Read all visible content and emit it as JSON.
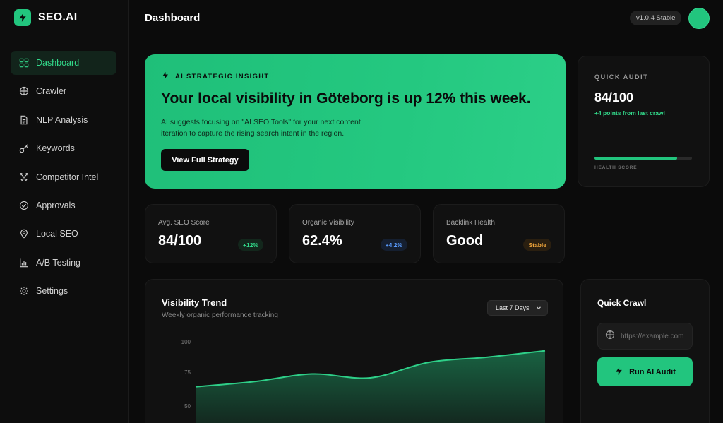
{
  "brand": {
    "name": "SEO.AI",
    "logo_icon": "bolt-icon",
    "accent": "#22c57e"
  },
  "sidebar": {
    "items": [
      {
        "label": "Dashboard",
        "icon": "grid-icon",
        "active": true
      },
      {
        "label": "Crawler",
        "icon": "globe-icon",
        "active": false
      },
      {
        "label": "NLP Analysis",
        "icon": "document-icon",
        "active": false
      },
      {
        "label": "Keywords",
        "icon": "key-icon",
        "active": false
      },
      {
        "label": "Competitor Intel",
        "icon": "swords-icon",
        "active": false
      },
      {
        "label": "Approvals",
        "icon": "check-circle-icon",
        "active": false
      },
      {
        "label": "Local SEO",
        "icon": "map-pin-icon",
        "active": false
      },
      {
        "label": "A/B Testing",
        "icon": "bar-chart-icon",
        "active": false
      },
      {
        "label": "Settings",
        "icon": "gear-icon",
        "active": false
      }
    ]
  },
  "header": {
    "title": "Dashboard",
    "version": "v1.0.4 Stable"
  },
  "insight": {
    "tag": "AI STRATEGIC INSIGHT",
    "headline": "Your local visibility in Göteborg is up 12% this week.",
    "body": "AI suggests focusing on \"AI SEO Tools\" for your next content iteration to capture the rising search intent in the region.",
    "button": "View Full Strategy"
  },
  "quick_audit": {
    "label": "QUICK AUDIT",
    "score": "84/100",
    "delta": "+4 points from last crawl",
    "health_label": "HEALTH SCORE",
    "health_fraction": 0.85
  },
  "stats": [
    {
      "label": "Avg. SEO Score",
      "value": "84/100",
      "badge": "+12%",
      "badge_color": "#32d98a"
    },
    {
      "label": "Organic Visibility",
      "value": "62.4%",
      "badge": "+4.2%",
      "badge_color": "#5a9cff"
    },
    {
      "label": "Backlink Health",
      "value": "Good",
      "badge": "Stable",
      "badge_color": "#f2a73b"
    }
  ],
  "trend": {
    "title": "Visibility Trend",
    "subtitle": "Weekly organic performance tracking",
    "range": "Last 7 Days"
  },
  "chart_data": {
    "type": "area",
    "x": [
      0,
      1,
      2,
      3,
      4,
      5,
      6
    ],
    "values": [
      65,
      69,
      75,
      72,
      84,
      88,
      93
    ],
    "ylim": [
      40,
      100
    ],
    "yticks": [
      "100",
      "75",
      "50"
    ],
    "line_color": "#2ecf88",
    "grid": false
  },
  "quick_crawl": {
    "title": "Quick Crawl",
    "placeholder": "https://example.com",
    "button": "Run AI Audit"
  }
}
